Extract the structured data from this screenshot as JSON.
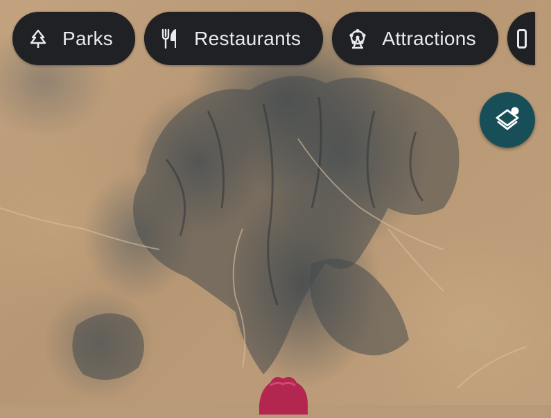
{
  "map": {
    "type": "satellite",
    "category_chips": [
      {
        "label": "Parks",
        "icon": "tree-icon"
      },
      {
        "label": "Restaurants",
        "icon": "fork-knife-icon"
      },
      {
        "label": "Attractions",
        "icon": "ferris-wheel-icon"
      }
    ],
    "layers_button": {
      "icon": "layers-icon"
    },
    "marker": {
      "icon": "location-pin-icon",
      "color": "#b3264f"
    }
  },
  "colors": {
    "chip_bg": "#202124",
    "chip_text": "#e8eaed",
    "layers_bg": "#174e58"
  }
}
